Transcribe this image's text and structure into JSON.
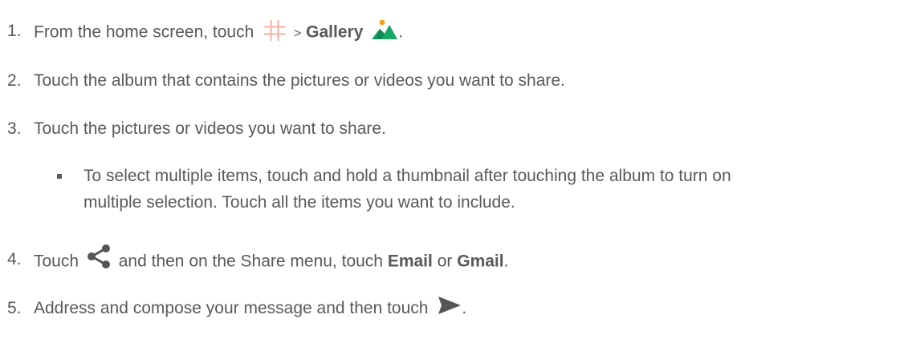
{
  "steps": [
    {
      "number": "1.",
      "pre": "From the home screen, touch",
      "sep": ">",
      "bold1": "Gallery",
      "post": "."
    },
    {
      "number": "2.",
      "text": "Touch the album that contains the pictures or videos you want to share."
    },
    {
      "number": "3.",
      "text": "Touch the pictures or videos you want to share."
    },
    {
      "number": "4.",
      "pre": "Touch",
      "mid": "and then on the Share menu, touch",
      "bold1": "Email",
      "or": "or",
      "bold2": "Gmail",
      "post": "."
    },
    {
      "number": "5.",
      "pre": "Address and compose your message and then touch",
      "post": "."
    }
  ],
  "sub_bullet": {
    "line1": "To select multiple items, touch and hold a thumbnail after touching the album to turn on",
    "line2": "multiple selection. Touch all the items you want to include."
  },
  "icons": {
    "apps": "apps-grid-icon",
    "gallery": "gallery-icon",
    "share": "share-icon",
    "send": "send-icon"
  },
  "colors": {
    "text": "#595959",
    "apps_grid": "#f2b8a8",
    "gallery_green": "#16a765",
    "gallery_sun": "#f7a11b",
    "icon_dark": "#555555"
  }
}
